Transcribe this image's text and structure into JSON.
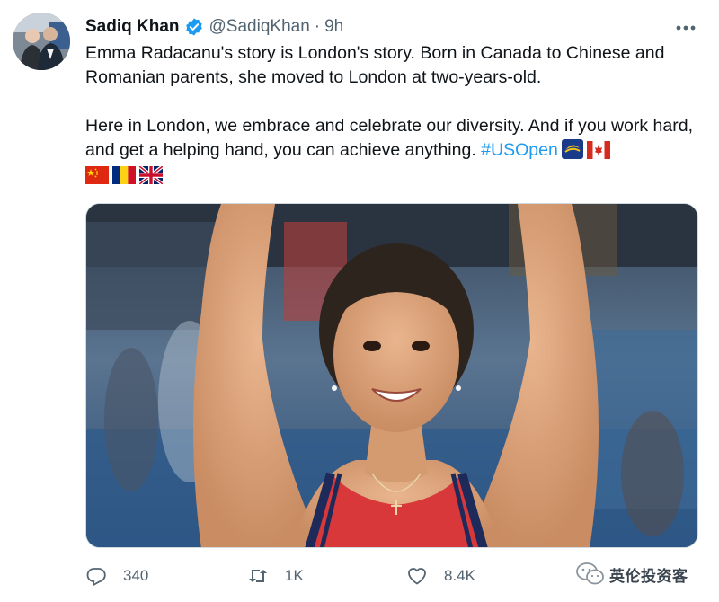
{
  "author": {
    "name": "Sadiq Khan",
    "handle": "@SadiqKhan",
    "separator": "·",
    "time": "9h",
    "verified": true
  },
  "tweet": {
    "paragraph1": "Emma Radacanu's story is London's story. Born in Canada to Chinese and Romanian parents, she moved to London at two-years-old.",
    "paragraph2_text": "Here in London, we embrace and celebrate our diversity. And if you work hard, and get a helping hand, you can achieve anything. ",
    "hashtag": "#USOpen",
    "inline_emoji": [
      "usopen-emoji",
      "canada-flag"
    ],
    "flag_emoji": [
      "china-flag",
      "romania-flag",
      "uk-flag"
    ]
  },
  "media": {
    "description_icon": "photo-of-smiling-tennis-player-with-raised-arms"
  },
  "actions": {
    "reply_count": "340",
    "retweet_count": "1K",
    "like_count": "8.4K"
  },
  "watermark": {
    "text": "英伦投资客"
  },
  "colors": {
    "accent": "#1d9bf0",
    "muted": "#536471",
    "text": "#0f1419"
  }
}
